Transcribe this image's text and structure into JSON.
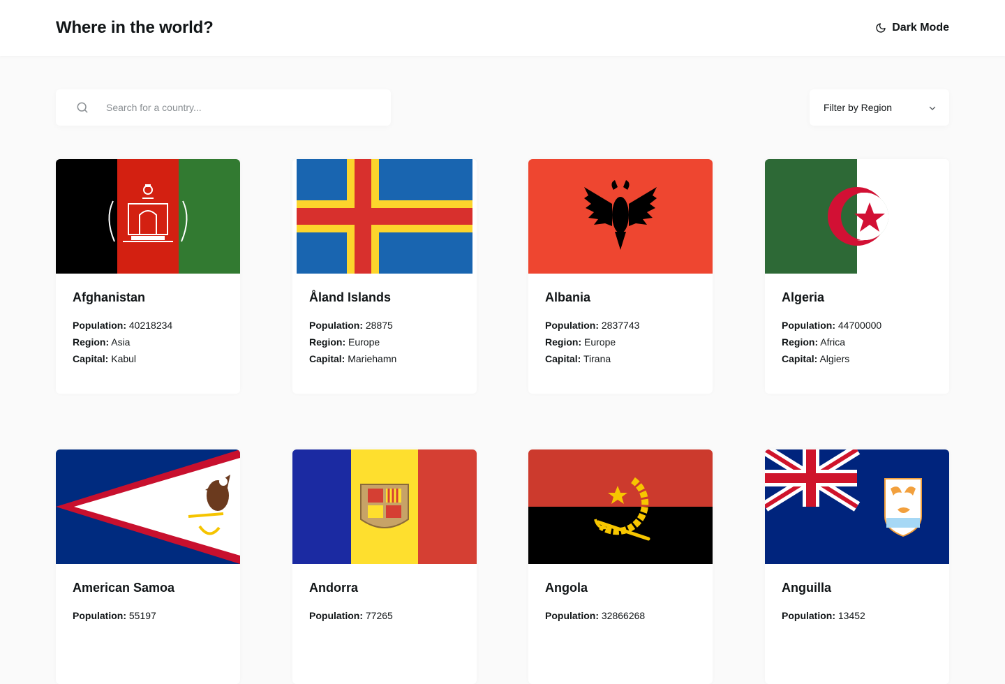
{
  "header": {
    "title": "Where in the world?",
    "dark_mode_label": "Dark Mode"
  },
  "search": {
    "placeholder": "Search for a country..."
  },
  "filter": {
    "label": "Filter by Region"
  },
  "labels": {
    "population": "Population:",
    "region": "Region:",
    "capital": "Capital:"
  },
  "countries": [
    {
      "name": "Afghanistan",
      "population": "40218234",
      "region": "Asia",
      "capital": "Kabul"
    },
    {
      "name": "Åland Islands",
      "population": "28875",
      "region": "Europe",
      "capital": "Mariehamn"
    },
    {
      "name": "Albania",
      "population": "2837743",
      "region": "Europe",
      "capital": "Tirana"
    },
    {
      "name": "Algeria",
      "population": "44700000",
      "region": "Africa",
      "capital": "Algiers"
    },
    {
      "name": "American Samoa",
      "population": "55197"
    },
    {
      "name": "Andorra",
      "population": "77265"
    },
    {
      "name": "Angola",
      "population": "32866268"
    },
    {
      "name": "Anguilla",
      "population": "13452"
    }
  ]
}
